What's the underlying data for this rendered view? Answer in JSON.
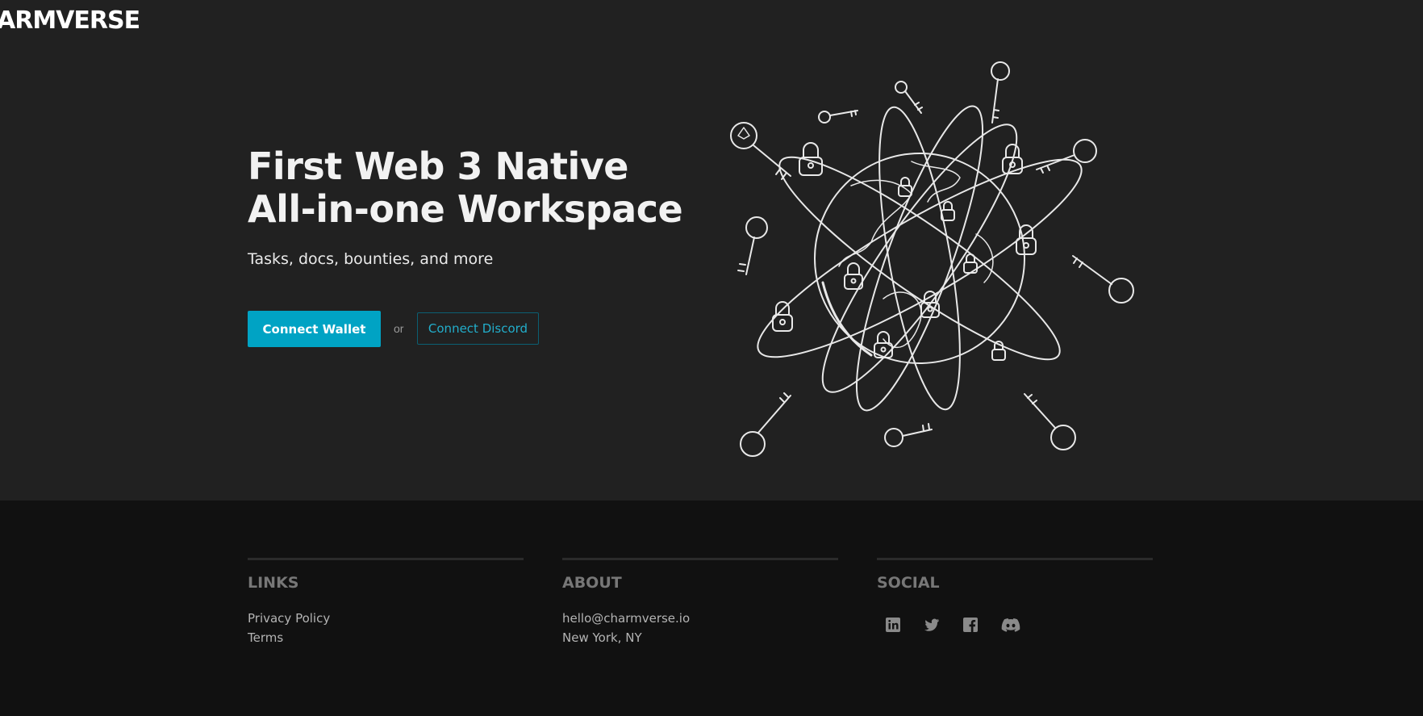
{
  "brand": {
    "logo_text": "ARMVERSE"
  },
  "hero": {
    "headline_line1": "First Web 3 Native",
    "headline_line2": "All-in-one Workspace",
    "subheadline": "Tasks, docs, bounties, and more",
    "connect_wallet_label": "Connect Wallet",
    "or_label": "or",
    "connect_discord_label": "Connect Discord"
  },
  "footer": {
    "links": {
      "heading": "LINKS",
      "items": [
        "Privacy Policy",
        "Terms"
      ]
    },
    "about": {
      "heading": "ABOUT",
      "email": "hello@charmverse.io",
      "location": "New York, NY"
    },
    "social": {
      "heading": "SOCIAL",
      "icons": [
        "linkedin-icon",
        "twitter-icon",
        "facebook-icon",
        "discord-icon"
      ]
    }
  },
  "colors": {
    "hero_bg": "#212121",
    "footer_bg": "#111111",
    "accent": "#00a3c4",
    "discord_text": "#22aecb"
  }
}
